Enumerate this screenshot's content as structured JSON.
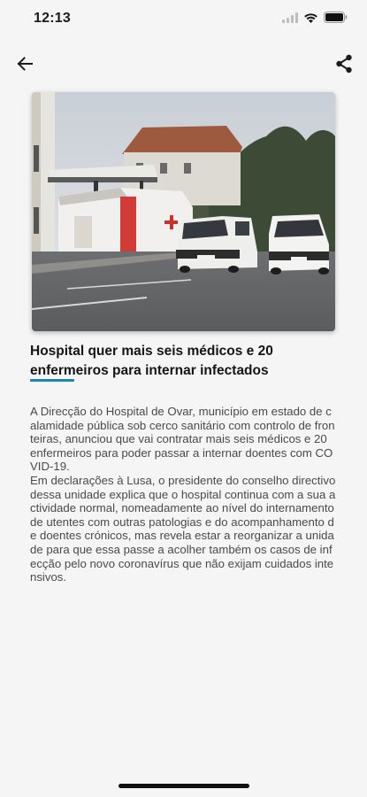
{
  "status_bar": {
    "time": "12:13",
    "icons": [
      "signal-icon",
      "wifi-icon",
      "battery-icon"
    ]
  },
  "app_bar": {
    "back_icon": "arrow-left-icon",
    "share_icon": "share-icon"
  },
  "article": {
    "title": "Hospital quer mais seis médicos e 20 enfermeiros para internar infectados",
    "body": "A Direcção do Hospital de Ovar, município em estado de calamidade pública sob cerco sanitário com controlo de fronteiras, anunciou que vai contratar mais seis médicos e 20 enfermeiros para poder passar a internar doentes com COVID-19.\nEm declarações à Lusa, o presidente do conselho directivo dessa unidade explica que o hospital continua com a sua actividade normal, nomeadamente ao nível do internamento de utentes com outras patologias e do acompanhamento de doentes crónicos, mas revela estar a reorganizar a unidade para que essa passe a acolher também os casos de infecção pelo novo coronavírus que não exijam cuidados intensivos.",
    "accent_color": "#1a86b5"
  }
}
